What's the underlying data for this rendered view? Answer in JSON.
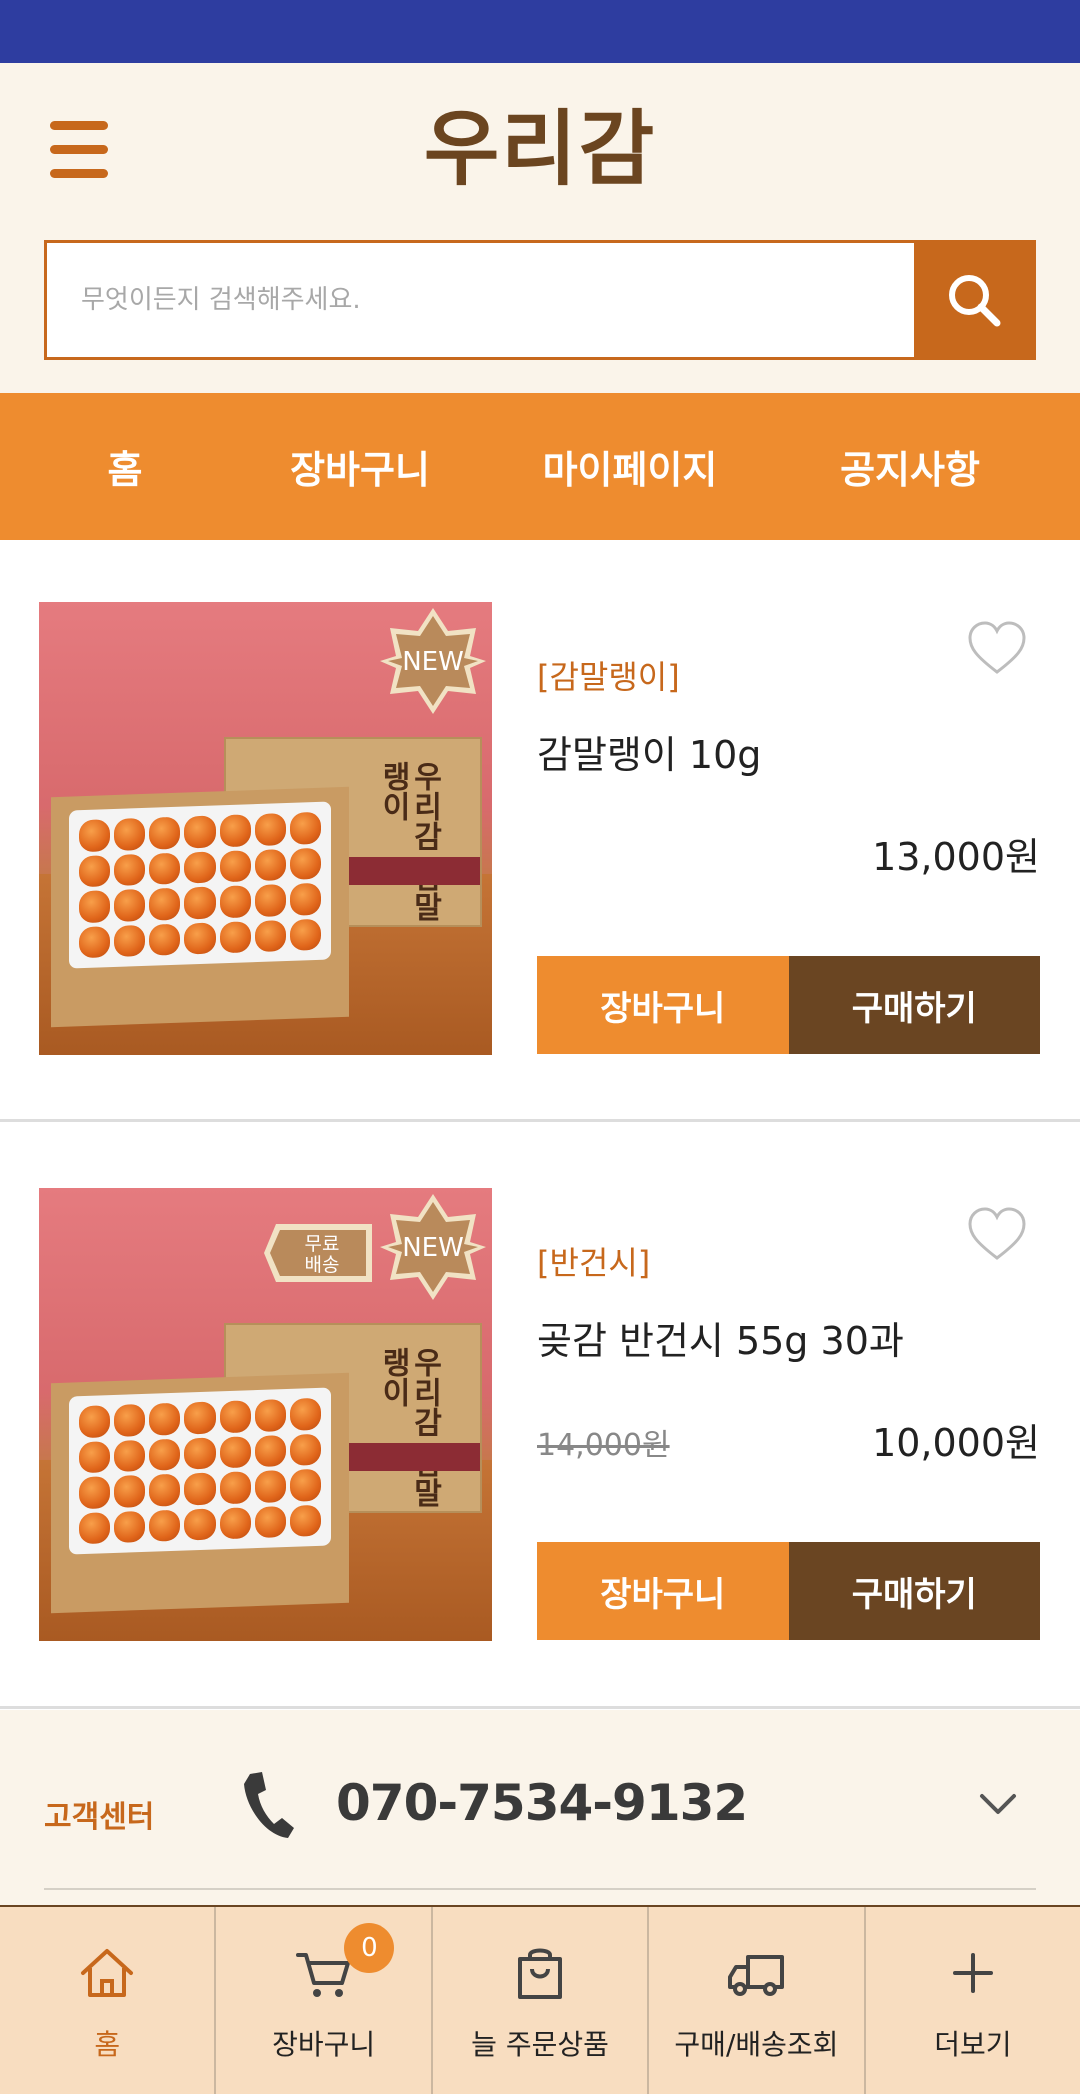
{
  "header": {
    "brand": "우리감",
    "search_placeholder": "무엇이든지 검색해주세요."
  },
  "nav": {
    "items": [
      {
        "label": "홈"
      },
      {
        "label": "장바구니"
      },
      {
        "label": "마이페이지"
      },
      {
        "label": "공지사항"
      }
    ]
  },
  "products": [
    {
      "category": "[감말랭이]",
      "name": "감말랭이 10g",
      "price": "13,000원",
      "original_price": "",
      "badges": [
        "NEW"
      ],
      "image_text": "우리감 감말랭이",
      "cart_label": "장바구니",
      "buy_label": "구매하기"
    },
    {
      "category": "[반건시]",
      "name": "곶감 반건시 55g 30과",
      "price": "10,000원",
      "original_price": "14,000원",
      "badges": [
        "무료배송",
        "NEW"
      ],
      "free_badge": "무료\n배송",
      "image_text": "우리감 감말랭이",
      "cart_label": "장바구니",
      "buy_label": "구매하기"
    }
  ],
  "customer_center": {
    "label": "고객센터",
    "phone": "070-7534-9132"
  },
  "tabbar": {
    "cart_count": "0",
    "tabs": [
      {
        "label": "홈",
        "icon": "home-icon"
      },
      {
        "label": "장바구니",
        "icon": "cart-icon"
      },
      {
        "label": "늘 주문상품",
        "icon": "bag-icon"
      },
      {
        "label": "구매/배송조회",
        "icon": "truck-icon"
      },
      {
        "label": "더보기",
        "icon": "plus-icon"
      }
    ]
  },
  "colors": {
    "status_bar": "#2e3da0",
    "accent": "#ee8c2f",
    "brown": "#6a4522",
    "orange_dark": "#c7681c",
    "cream": "#faf4ea"
  }
}
